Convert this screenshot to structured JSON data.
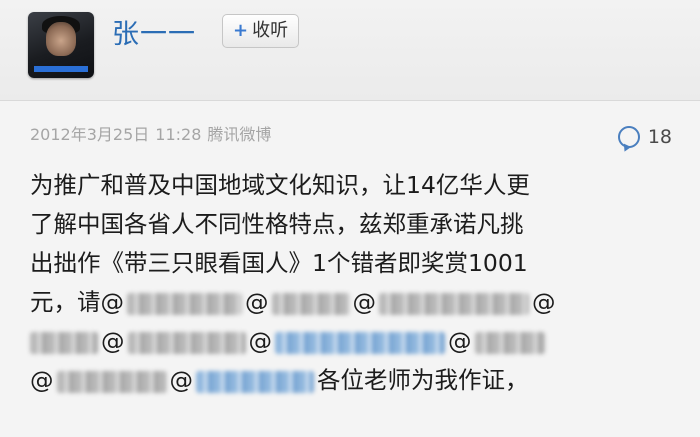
{
  "user": {
    "name": "张一一",
    "follow_label": "收听",
    "follow_icon": "+"
  },
  "meta": {
    "date": "2012年3月25日",
    "time": "11:28",
    "source": "腾讯微博"
  },
  "comments": {
    "count": "18",
    "icon": "comment-icon"
  },
  "content": {
    "line1": "为推广和普及中国地域文化知识，让14亿华人更",
    "line2": "了解中国各省人不同性格特点，兹郑重承诺凡挑",
    "line3": "出拙作《带三只眼看国人》1个错者即奖赏1001",
    "line4_prefix": "元，请@",
    "at": "@",
    "closing": "各位老师为我作证，"
  },
  "colors": {
    "name_blue": "#2b6db5",
    "meta_grey": "#a5a5a5",
    "background": "#f4f4f4"
  }
}
